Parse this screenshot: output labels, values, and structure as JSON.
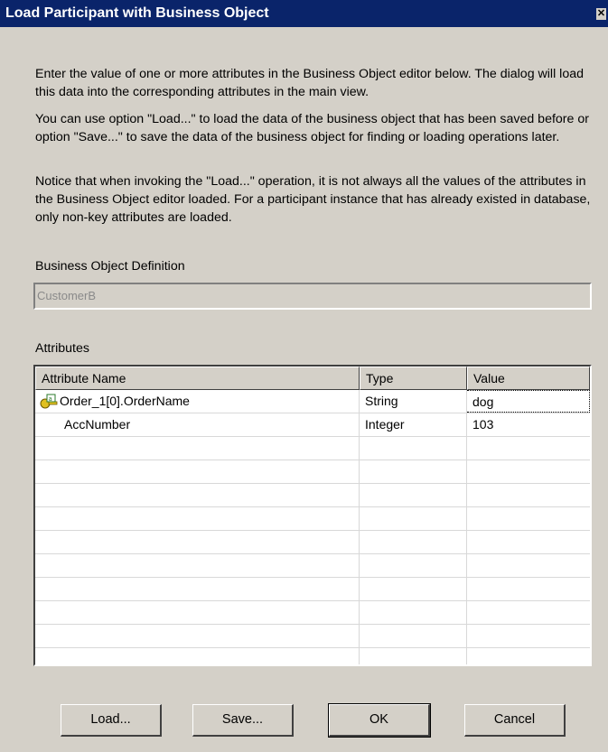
{
  "window": {
    "title": "Load Participant with Business Object",
    "close_glyph": "✕"
  },
  "intro": {
    "paragraph1": "Enter the value of one or more attributes in the Business Object editor below. The dialog will load this data into the corresponding attributes in the main view.",
    "paragraph2": "You can use option \"Load...\" to load the data of the business object that has been saved before or option \"Save...\" to save the data of the business object for finding or loading operations later.",
    "paragraph3": "Notice that when invoking the \"Load...\" operation, it is not always all the values of the attributes in the Business Object editor loaded.  For a participant instance that has already existed in database, only non-key attributes are loaded."
  },
  "bo_definition": {
    "label": "Business Object Definition",
    "value": "CustomerB"
  },
  "attributes": {
    "label": "Attributes",
    "columns": [
      "Attribute Name",
      "Type",
      "Value"
    ],
    "rows": [
      {
        "name": "Order_1[0].OrderName",
        "type": "String",
        "value": "dog",
        "icon": "key-attribute-icon"
      },
      {
        "name": "AccNumber",
        "type": "Integer",
        "value": "103",
        "icon": ""
      }
    ]
  },
  "buttons": {
    "load": "Load...",
    "save": "Save...",
    "ok": "OK",
    "cancel": "Cancel"
  },
  "colors": {
    "titlebar": "#0a246a",
    "dialog_bg": "#d4d0c8"
  }
}
